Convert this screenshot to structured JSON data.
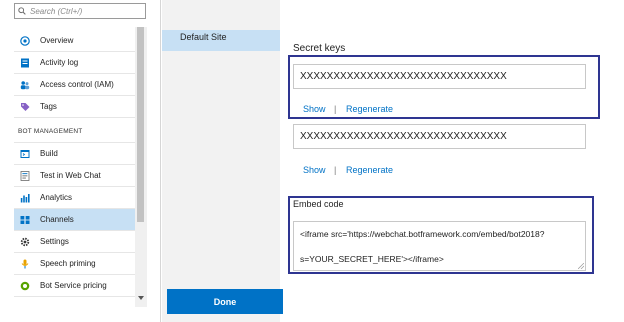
{
  "search": {
    "placeholder": "Search (Ctrl+/)"
  },
  "sidebar": {
    "items_top": [
      {
        "label": "Overview",
        "icon": "overview-icon"
      },
      {
        "label": "Activity log",
        "icon": "activity-log-icon"
      },
      {
        "label": "Access control (IAM)",
        "icon": "access-control-icon"
      },
      {
        "label": "Tags",
        "icon": "tag-icon"
      }
    ],
    "section_header": "BOT MANAGEMENT",
    "items_bot": [
      {
        "label": "Build",
        "icon": "build-icon"
      },
      {
        "label": "Test in Web Chat",
        "icon": "web-chat-icon"
      },
      {
        "label": "Analytics",
        "icon": "analytics-icon"
      },
      {
        "label": "Channels",
        "icon": "channels-icon",
        "active": true
      },
      {
        "label": "Settings",
        "icon": "gear-icon"
      },
      {
        "label": "Speech priming",
        "icon": "speech-priming-icon"
      },
      {
        "label": "Bot Service pricing",
        "icon": "pricing-icon"
      }
    ]
  },
  "sites": {
    "selected": "Default Site"
  },
  "secret_keys": {
    "title": "Secret keys",
    "key1": "XXXXXXXXXXXXXXXXXXXXXXXXXXXXXXX",
    "key2": "XXXXXXXXXXXXXXXXXXXXXXXXXXXXXXX",
    "show_label": "Show",
    "separator": "|",
    "regenerate_label": "Regenerate"
  },
  "embed": {
    "title": "Embed code",
    "line1": "<iframe src='https://webchat.botframework.com/embed/bot2018?",
    "line2": "s=YOUR_SECRET_HERE'></iframe>"
  },
  "footer": {
    "done_label": "Done"
  },
  "colors": {
    "accent": "#0072c6",
    "highlight_border": "#2e3591",
    "active_row": "#c7e0f4"
  }
}
